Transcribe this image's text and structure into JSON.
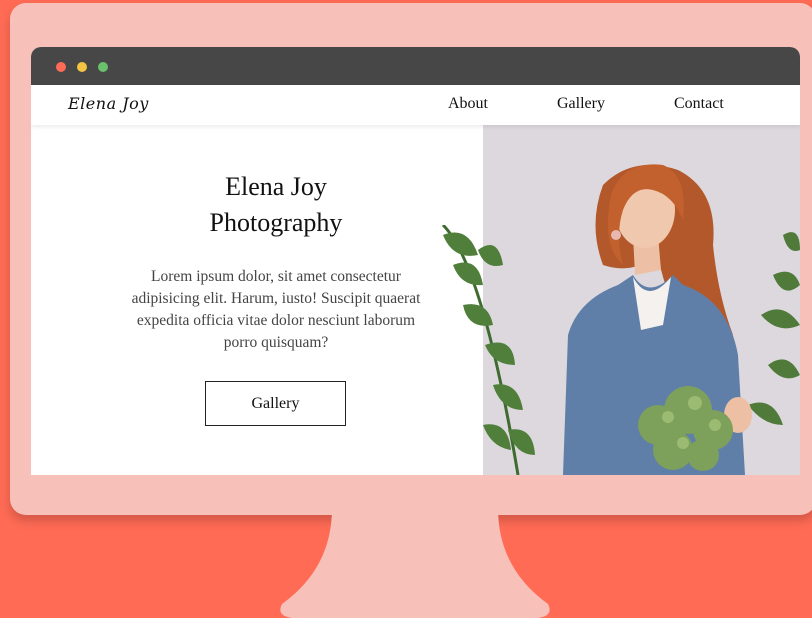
{
  "browser": {
    "logo_text": "Elena Joy"
  },
  "nav": {
    "items": [
      {
        "label": "About"
      },
      {
        "label": "Gallery"
      },
      {
        "label": "Contact"
      }
    ]
  },
  "hero": {
    "title_line1": "Elena Joy",
    "title_line2": "Photography",
    "description": "Lorem ipsum dolor, sit amet consectetur adipisicing elit. Harum, iusto! Suscipit quaerat expedita officia vitae dolor nesciunt laborum porro quisquam?",
    "button_label": "Gallery"
  },
  "colors": {
    "background": "#FF6B55",
    "monitor": "#F7C1B9",
    "titlebar": "#474747",
    "photo_background": "#DCD8DD"
  },
  "icons": {
    "window_controls": [
      "close-dot",
      "minimize-dot",
      "maximize-dot"
    ]
  }
}
